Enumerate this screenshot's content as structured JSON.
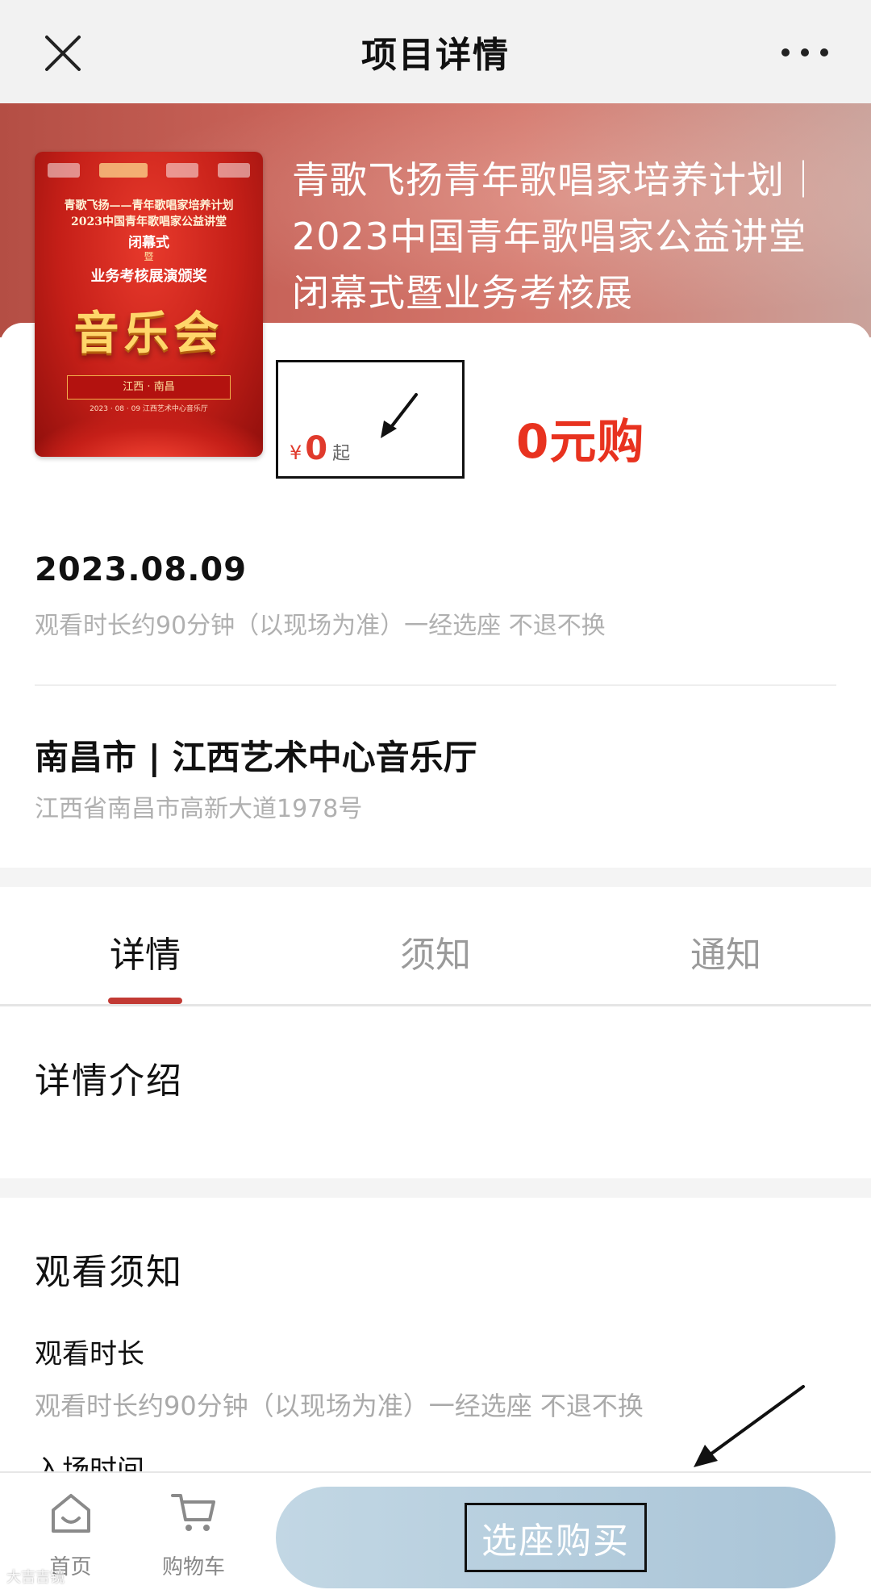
{
  "header": {
    "title": "项目详情",
    "close_icon": "close-icon",
    "more_icon": "more-icon"
  },
  "event": {
    "title": "青歌飞扬青年歌唱家培养计划｜2023中国青年歌唱家公益讲堂闭幕式暨业务考核展"
  },
  "poster": {
    "line1": "青歌飞扬——青年歌唱家培养计划",
    "line2": "2023中国青年歌唱家公益讲堂",
    "line3": "闭幕式",
    "line4": "暨",
    "line5": "业务考核展演颁奖",
    "big": "音乐会",
    "place": "江西 · 南昌",
    "date": "2023 · 08 · 09   江西艺术中心音乐厅"
  },
  "price": {
    "currency": "¥",
    "amount": "0",
    "suffix": "起",
    "promo": "0元购",
    "promo_color": "#e8321f"
  },
  "schedule": {
    "date": "2023.08.09",
    "note": "观看时长约90分钟（以现场为准）一经选座 不退不换"
  },
  "venue": {
    "name": "南昌市 | 江西艺术中心音乐厅",
    "address": "江西省南昌市高新大道1978号"
  },
  "tabs": [
    {
      "label": "详情",
      "active": true
    },
    {
      "label": "须知",
      "active": false
    },
    {
      "label": "通知",
      "active": false
    }
  ],
  "details": {
    "title": "详情介绍"
  },
  "notice": {
    "title": "观看须知",
    "item1_label": "观看时长",
    "item1_text": "观看时长约90分钟（以现场为准）一经选座 不退不换",
    "item2_label": "入场时间"
  },
  "bottom_nav": {
    "home_label": "首页",
    "cart_label": "购物车",
    "buy_label": "选座购买",
    "accent": "#c23a34",
    "buy_button_color": "#b4cddd"
  },
  "watermark": "大吉吉镜"
}
